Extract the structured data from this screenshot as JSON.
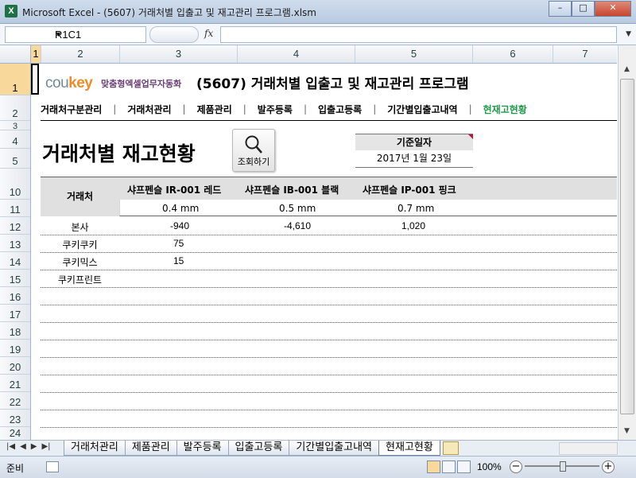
{
  "window": {
    "icon_letter": "X",
    "title": "Microsoft Excel - (5607) 거래처별 입출고 및 재고관리 프로그램.xlsm",
    "btn_min": "–",
    "btn_max": "□",
    "btn_close": "✕"
  },
  "formula_bar": {
    "name_box": "R1C1",
    "fx": "fx",
    "formula": ""
  },
  "columns": [
    "1",
    "2",
    "3",
    "4",
    "5",
    "6",
    "7"
  ],
  "rows": [
    "1",
    "2",
    "3",
    "4",
    "5",
    "10",
    "11",
    "12",
    "13",
    "14",
    "15",
    "16",
    "17",
    "18",
    "19",
    "20",
    "21",
    "22",
    "23",
    "24"
  ],
  "header": {
    "logo_a": "cou",
    "logo_b": "key",
    "logo_sub": "맞춤형엑셀업무자동화",
    "program_title": "(5607) 거래처별 입출고 및 재고관리 프로그램"
  },
  "nav": [
    {
      "label": "거래처구분관리",
      "active": false
    },
    {
      "label": "거래처관리",
      "active": false
    },
    {
      "label": "제품관리",
      "active": false
    },
    {
      "label": "발주등록",
      "active": false
    },
    {
      "label": "입출고등록",
      "active": false
    },
    {
      "label": "기간별입출고내역",
      "active": false
    },
    {
      "label": "현재고현황",
      "active": true
    }
  ],
  "page": {
    "heading": "거래처별 재고현황",
    "search_label": "조회하기",
    "date_label": "기준일자",
    "date_value": "2017년 1월 23일"
  },
  "table": {
    "client_header": "거래처",
    "products": [
      {
        "name": "샤프펜슬 IR-001 레드",
        "spec": "0.4 mm"
      },
      {
        "name": "샤프펜슬 IB-001 블랙",
        "spec": "0.5 mm"
      },
      {
        "name": "샤프펜슬 IP-001 핑크",
        "spec": "0.7 mm"
      }
    ],
    "rows": [
      {
        "client": "본사",
        "values": [
          "-940",
          "-4,610",
          "1,020"
        ]
      },
      {
        "client": "쿠키쿠키",
        "values": [
          "75",
          "",
          ""
        ]
      },
      {
        "client": "쿠키믹스",
        "values": [
          "15",
          "",
          ""
        ]
      },
      {
        "client": "쿠키프린트",
        "values": [
          "",
          "",
          ""
        ]
      }
    ]
  },
  "sheet_tabs": [
    {
      "label": "거래처관리",
      "active": false
    },
    {
      "label": "제품관리",
      "active": false
    },
    {
      "label": "발주등록",
      "active": false
    },
    {
      "label": "입출고등록",
      "active": false
    },
    {
      "label": "기간별입출고내역",
      "active": false
    },
    {
      "label": "현재고현황",
      "active": true
    }
  ],
  "status": {
    "ready": "준비",
    "zoom": "100%",
    "zoom_level_percent": 100
  }
}
